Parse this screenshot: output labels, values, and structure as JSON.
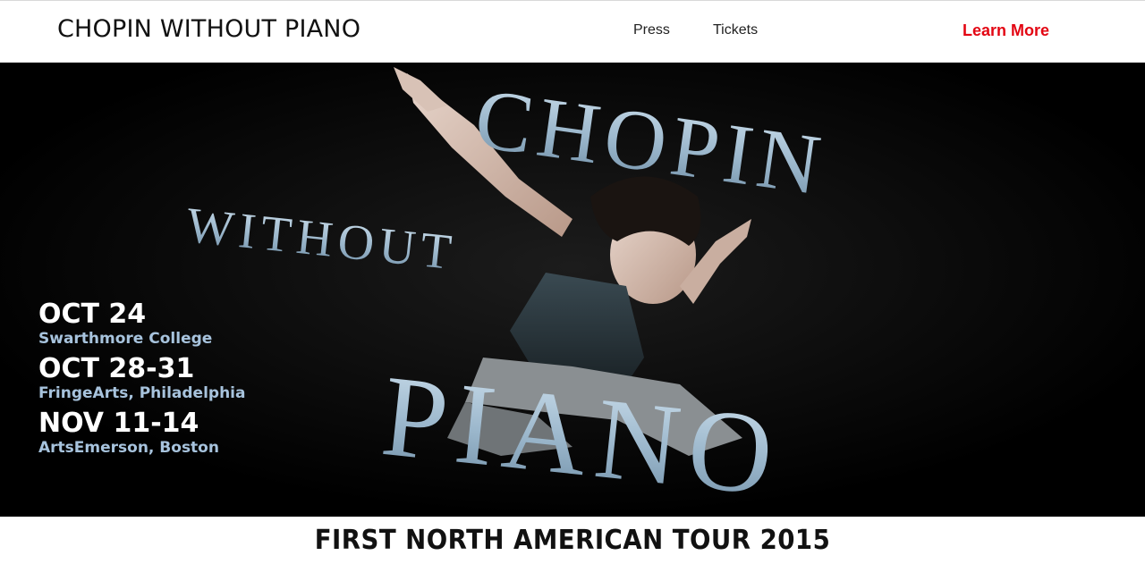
{
  "header": {
    "title": "CHOPIN WITHOUT PIANO",
    "nav": {
      "press": "Press",
      "tickets": "Tickets"
    },
    "cta": {
      "label": "Learn More",
      "color": "#e30613"
    }
  },
  "hero": {
    "title_words": {
      "chopin": "CHOPIN",
      "without": "WITHOUT",
      "piano": "PIANO"
    },
    "dates": [
      {
        "date": "OCT 24",
        "venue": "Swarthmore College"
      },
      {
        "date": "OCT 28-31",
        "venue": "FringeArts, Philadelphia"
      },
      {
        "date": "NOV 11-14",
        "venue": "ArtsEmerson, Boston"
      }
    ],
    "venue_color": "#a7c3dd",
    "title_color": "#9ab6cb"
  },
  "banner": {
    "text": "FIRST NORTH AMERICAN TOUR 2015"
  }
}
